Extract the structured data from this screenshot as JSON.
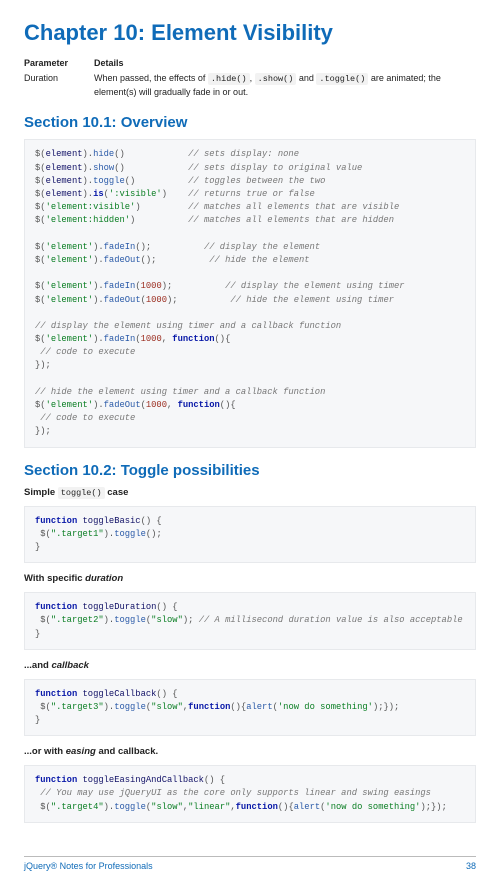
{
  "chapter_title": "Chapter 10: Element Visibility",
  "params_table": {
    "head_param": "Parameter",
    "head_details": "Details",
    "row_label": "Duration",
    "row_pre": "When passed, the effects of ",
    "row_c1": ".hide()",
    "row_c2": ".show()",
    "row_c3": ".toggle()",
    "row_sep": ", ",
    "row_and": " and ",
    "row_post": " are animated; the element(s) will gradually fade in or out."
  },
  "section1_title": "Section 10.1: Overview",
  "code1": {
    "l1": "$(element).hide()            // sets display: none",
    "l2": "$(element).show()            // sets display to original value",
    "l3": "$(element).toggle()          // toggles between the two",
    "l4": "$(element).is(':visible')    // returns true or false",
    "l5": "$('element:visible')         // matches all elements that are visible",
    "l6": "$('element:hidden')          // matches all elements that are hidden",
    "l7": "$('element').fadeIn();          // display the element",
    "l8": "$('element').fadeOut();          // hide the element",
    "l9": "$('element').fadeIn(1000);          // display the element using timer",
    "l10": "$('element').fadeOut(1000);          // hide the element using timer",
    "l11": "// display the element using timer and a callback function",
    "l12": "$('element').fadeIn(1000, function(){",
    "l13": " // code to execute",
    "l14": "});",
    "l15": "// hide the element using timer and a callback function",
    "l16": "$('element').fadeOut(1000, function(){",
    "l17": " // code to execute",
    "l18": "});"
  },
  "section2_title": "Section 10.2: Toggle possibilities",
  "sub1_pre": "Simple ",
  "sub1_code": "toggle()",
  "sub1_post": " case",
  "code2": {
    "fn": "toggleBasic",
    "target": ".target1"
  },
  "sub2_pre": "With specific ",
  "sub2_em": "duration",
  "code3": {
    "fn": "toggleDuration",
    "target": ".target2",
    "arg": "\"slow\"",
    "cmt": "// A millisecond duration value is also acceptable"
  },
  "sub3_pre": "...and ",
  "sub3_em": "callback",
  "code4": {
    "fn": "toggleCallback",
    "target": ".target3",
    "arg1": "\"slow\"",
    "alert": "'now do something'"
  },
  "sub4_pre": "...or with ",
  "sub4_em": "easing",
  "sub4_post": " and callback.",
  "code5": {
    "fn": "toggleEasingAndCallback",
    "cmt": "// You may use jQueryUI as the core only supports linear and swing easings",
    "target": ".target4",
    "arg1": "\"slow\"",
    "arg2": "\"linear\"",
    "alert": "'now do something'"
  },
  "footer_left": "jQuery® Notes for Professionals",
  "footer_right": "38"
}
